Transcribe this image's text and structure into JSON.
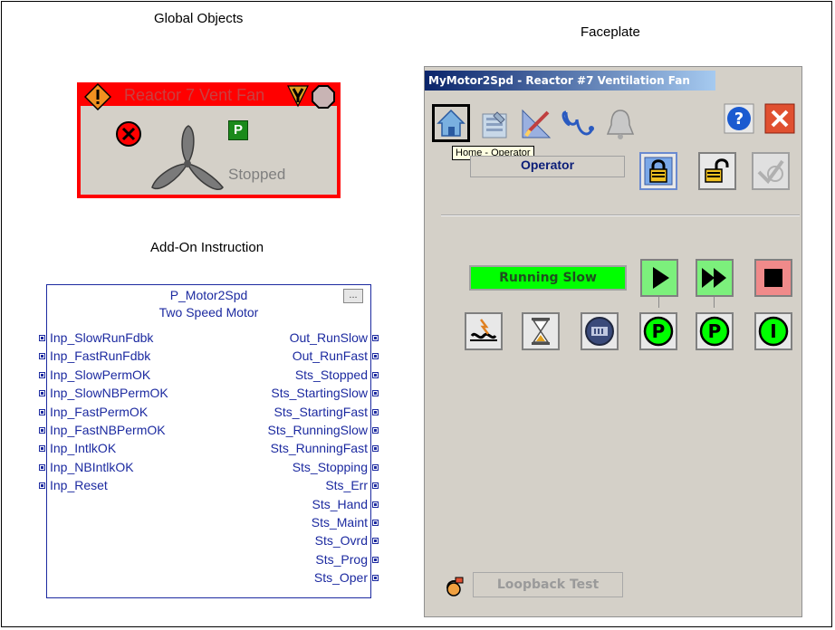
{
  "sections": {
    "global_objects": "Global Objects",
    "faceplate": "Faceplate",
    "add_on_instruction": "Add-On Instruction"
  },
  "global_object": {
    "title": "Reactor 7 Vent Fan",
    "status": "Stopped",
    "permissive_badge": "P",
    "icons": [
      "warning-icon",
      "maintenance-icon",
      "state-indicator-icon",
      "error-icon",
      "fan-icon"
    ]
  },
  "aoi": {
    "name": "P_Motor2Spd",
    "description": "Two Speed Motor",
    "button": "...",
    "inputs": [
      "Inp_SlowRunFdbk",
      "Inp_FastRunFdbk",
      "Inp_SlowPermOK",
      "Inp_SlowNBPermOK",
      "Inp_FastPermOK",
      "Inp_FastNBPermOK",
      "Inp_IntlkOK",
      "Inp_NBIntlkOK",
      "Inp_Reset"
    ],
    "outputs": [
      "Out_RunSlow",
      "Out_RunFast",
      "Sts_Stopped",
      "Sts_StartingSlow",
      "Sts_StartingFast",
      "Sts_RunningSlow",
      "Sts_RunningFast",
      "Sts_Stopping",
      "Sts_Err",
      "Sts_Hand",
      "Sts_Maint",
      "Sts_Ovrd",
      "Sts_Prog",
      "Sts_Oper"
    ]
  },
  "faceplate": {
    "title": "MyMotor2Spd - Reactor #7 Ventilation Fan",
    "tooltip": "Home - Operator",
    "mode": "Operator",
    "status": "Running Slow",
    "loopback": "Loopback Test",
    "permissive_labels": [
      "P",
      "P",
      "I"
    ],
    "toolbar_icons": [
      "home-icon",
      "engineering-icon",
      "maintenance-icon",
      "diagnostics-icon",
      "alarm-bell-icon",
      "help-icon",
      "close-icon"
    ],
    "colors": {
      "running": "#00ff00",
      "start_slow_btn": "#7cf07c",
      "stop_btn": "#f08a8a",
      "title_bar": "#0a246a",
      "aoi_text": "#1c2aa0"
    }
  }
}
